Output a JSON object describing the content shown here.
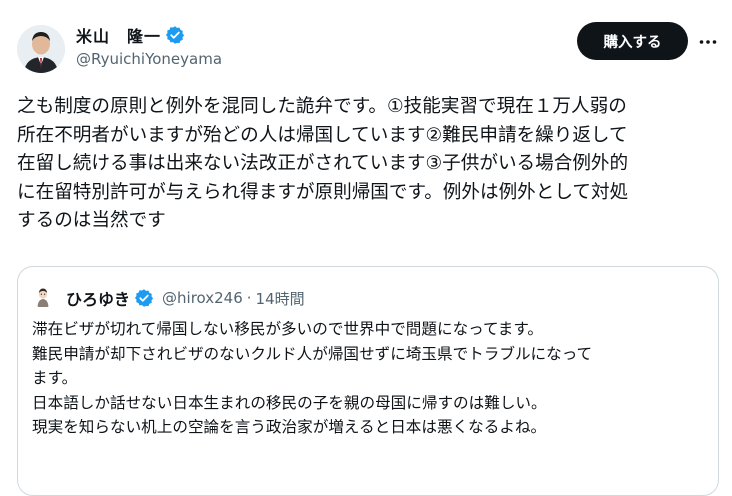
{
  "author": {
    "name": "米山　隆一",
    "handle": "@RyuichiYoneyama",
    "verified": true
  },
  "actions": {
    "subscribe_label": "購入する",
    "more_icon": "more-horizontal-icon"
  },
  "tweet": {
    "text": "之も制度の原則と例外を混同した詭弁です。①技能実習で現在１万人弱の\n所在不明者がいますが殆どの人は帰国しています②難民申請を繰り返して\n在留し続ける事は出来ない法改正がされています③子供がいる場合例外的\nに在留特別許可が与えられ得ますが原則帰国です。例外は例外として対処\nするのは当然です"
  },
  "quoted_tweet": {
    "name": "ひろゆき",
    "handle": "@hirox246",
    "separator": "·",
    "time": "14時間",
    "verified": true,
    "text": "滞在ビザが切れて帰国しない移民が多いので世界中で問題になってます。\n難民申請が却下されビザのないクルド人が帰国せずに埼玉県でトラブルになって\nます。\n日本語しか話せない日本生まれの移民の子を親の母国に帰すのは難しい。\n現実を知らない机上の空論を言う政治家が増えると日本は悪くなるよね。"
  },
  "colors": {
    "text": "#0f1419",
    "secondary": "#536471",
    "verified_badge": "#1d9bf0",
    "button_bg": "#0f1419",
    "border": "#cfd9de"
  }
}
